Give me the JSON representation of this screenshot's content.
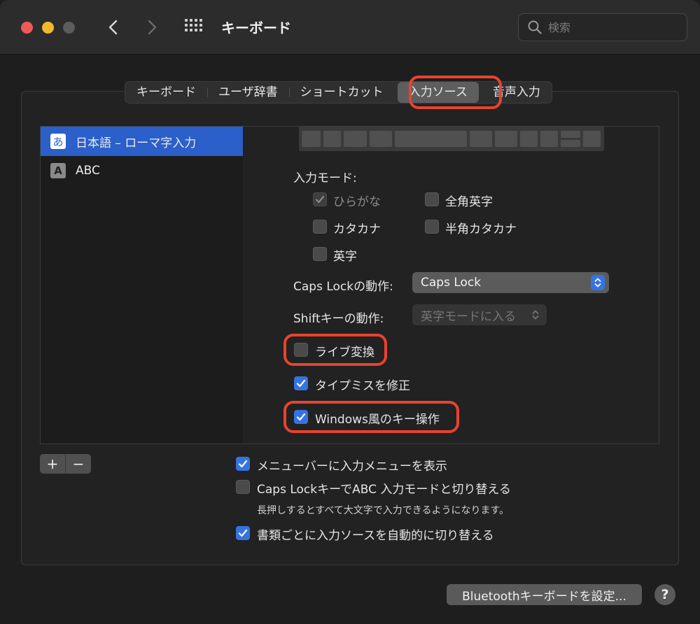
{
  "window": {
    "title": "キーボード"
  },
  "search": {
    "placeholder": "検索"
  },
  "tabs": [
    {
      "label": "キーボード"
    },
    {
      "label": "ユーザ辞書"
    },
    {
      "label": "ショートカット"
    },
    {
      "label": "入力ソース",
      "selected": true
    },
    {
      "label": "音声入力"
    }
  ],
  "sources": [
    {
      "icon_text": "あ",
      "label": "日本語 – ローマ字入力",
      "selected": true
    },
    {
      "icon_text": "A",
      "label": "ABC",
      "selected": false
    }
  ],
  "input_mode": {
    "title": "入力モード:",
    "options": [
      {
        "label": "ひらがな",
        "checked": true,
        "disabled": true
      },
      {
        "label": "全角英字",
        "checked": false
      },
      {
        "label": "カタカナ",
        "checked": false
      },
      {
        "label": "半角カタカナ",
        "checked": false
      },
      {
        "label": "英字",
        "checked": false
      }
    ]
  },
  "caps_lock": {
    "label": "Caps Lockの動作:",
    "value": "Caps Lock"
  },
  "shift": {
    "label": "Shiftキーの動作:",
    "value": "英字モードに入る"
  },
  "options": {
    "live_conversion": {
      "label": "ライブ変換",
      "checked": false
    },
    "typo_correction": {
      "label": "タイプミスを修正",
      "checked": true
    },
    "windows_keys": {
      "label": "Windows風のキー操作",
      "checked": true
    }
  },
  "list_controls": {
    "add": "+",
    "remove": "−"
  },
  "global": {
    "show_menu": {
      "label": "メニューバーに入力メニューを表示",
      "checked": true
    },
    "caps_switch": {
      "label": "Caps LockキーでABC 入力モードと切り替える",
      "checked": false,
      "note": "長押しするとすべて大文字で入力できるようになります。"
    },
    "auto_switch": {
      "label": "書類ごとに入力ソースを自動的に切り替える",
      "checked": true
    }
  },
  "footer": {
    "bluetooth_button": "Bluetoothキーボードを設定...",
    "help": "?"
  },
  "colors": {
    "accent": "#3574e0",
    "highlight": "#e8432f",
    "selection": "#2b5fc9"
  }
}
